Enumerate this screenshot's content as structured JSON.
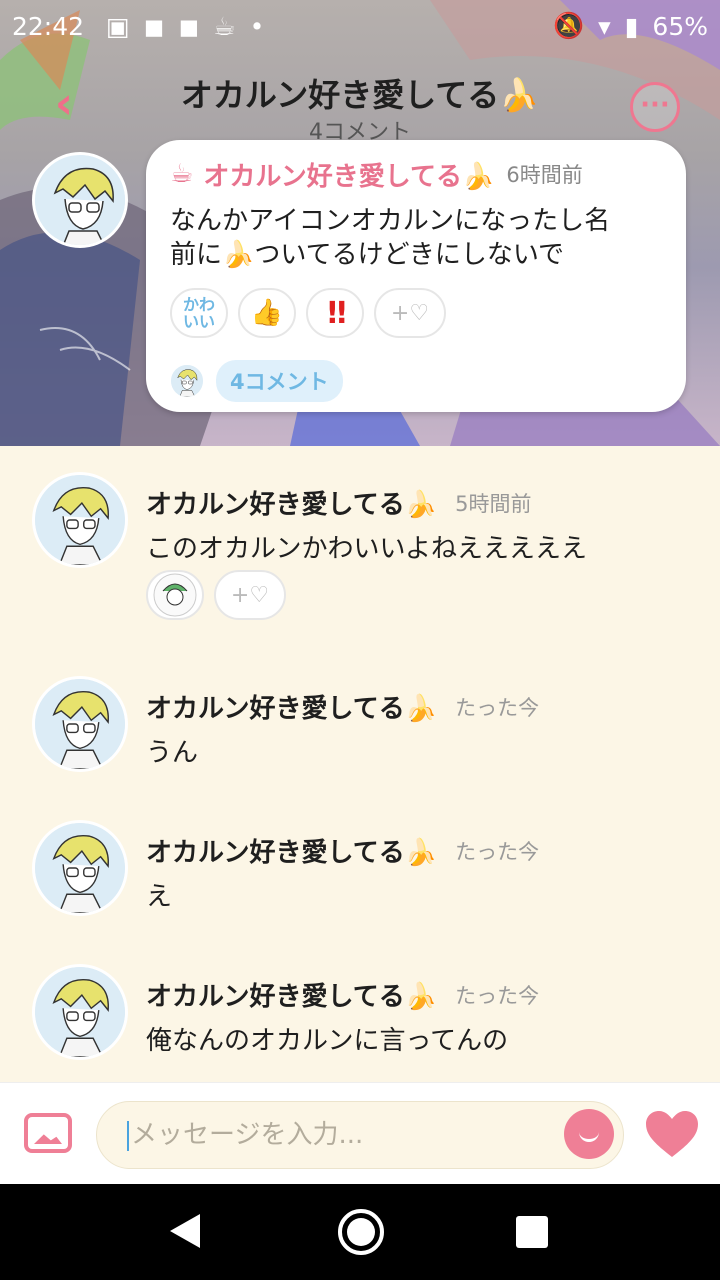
{
  "status_bar": {
    "time": "22:42",
    "battery": "65%"
  },
  "header": {
    "title": "オカルン好き愛してる🍌",
    "subtitle": "4コメント",
    "back_icon": "chevron-left-icon",
    "more_icon": "ellipsis-icon"
  },
  "post": {
    "author": "オカルン好き愛してる🍌",
    "time": "6時間前",
    "text_line1": "なんかアイコンオカルンになったし名",
    "text_line2": "前に🍌ついてるけどきにしないで",
    "reactions": {
      "kawaii": "かわいい",
      "thumbs": "👍",
      "exclaim": "‼",
      "add": "+♡"
    },
    "comment_count_label": "4コメント"
  },
  "comments": [
    {
      "author": "オカルン好き愛してる🍌",
      "time": "5時間前",
      "text": "このオカルンかわいいよねえええええ",
      "add_reaction": "+♡"
    },
    {
      "author": "オカルン好き愛してる🍌",
      "time": "たった今",
      "text": "うん"
    },
    {
      "author": "オカルン好き愛してる🍌",
      "time": "たった今",
      "text": "え"
    },
    {
      "author": "オカルン好き愛してる🍌",
      "time": "たった今",
      "text": "俺なんのオカルンに言ってんの"
    }
  ],
  "input_bar": {
    "placeholder": "メッセージを入力..."
  },
  "colors": {
    "accent": "#ef7f96",
    "background": "#fcf6e6",
    "comment_chip": "#6fb8e3"
  }
}
